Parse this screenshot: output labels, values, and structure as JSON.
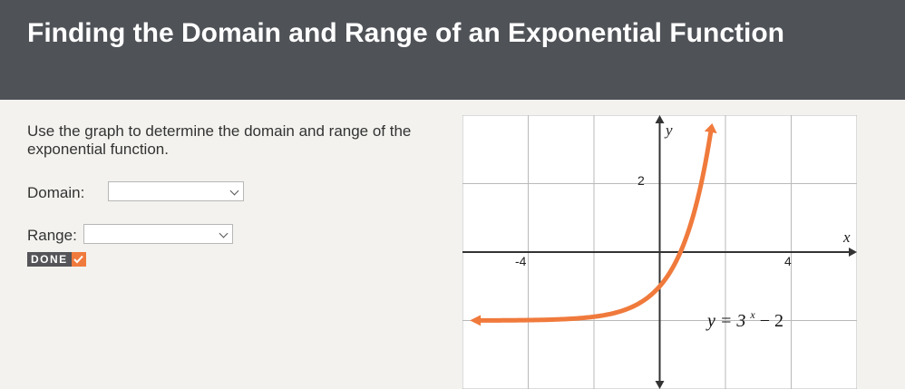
{
  "header": {
    "title": "Finding the Domain and Range of an Exponential Function"
  },
  "prompt": {
    "text": "Use the graph to determine the domain and range of the exponential function."
  },
  "form": {
    "domain_label": "Domain:",
    "domain_value": "",
    "range_label": "Range:",
    "range_value": "",
    "done_label": "DONE"
  },
  "graph": {
    "x_axis_label": "x",
    "y_axis_label": "y",
    "tick_x_neg": "-4",
    "tick_x_pos": "4",
    "tick_y_pos": "2",
    "equation_prefix": "y = 3",
    "equation_exponent": "x",
    "equation_suffix": " − 2",
    "curve_color": "#f07a3c",
    "xlim": [
      -6,
      6
    ],
    "ylim": [
      -4,
      4
    ]
  },
  "icons": {
    "dropdown": "chevron-down-icon",
    "check": "check-icon"
  }
}
